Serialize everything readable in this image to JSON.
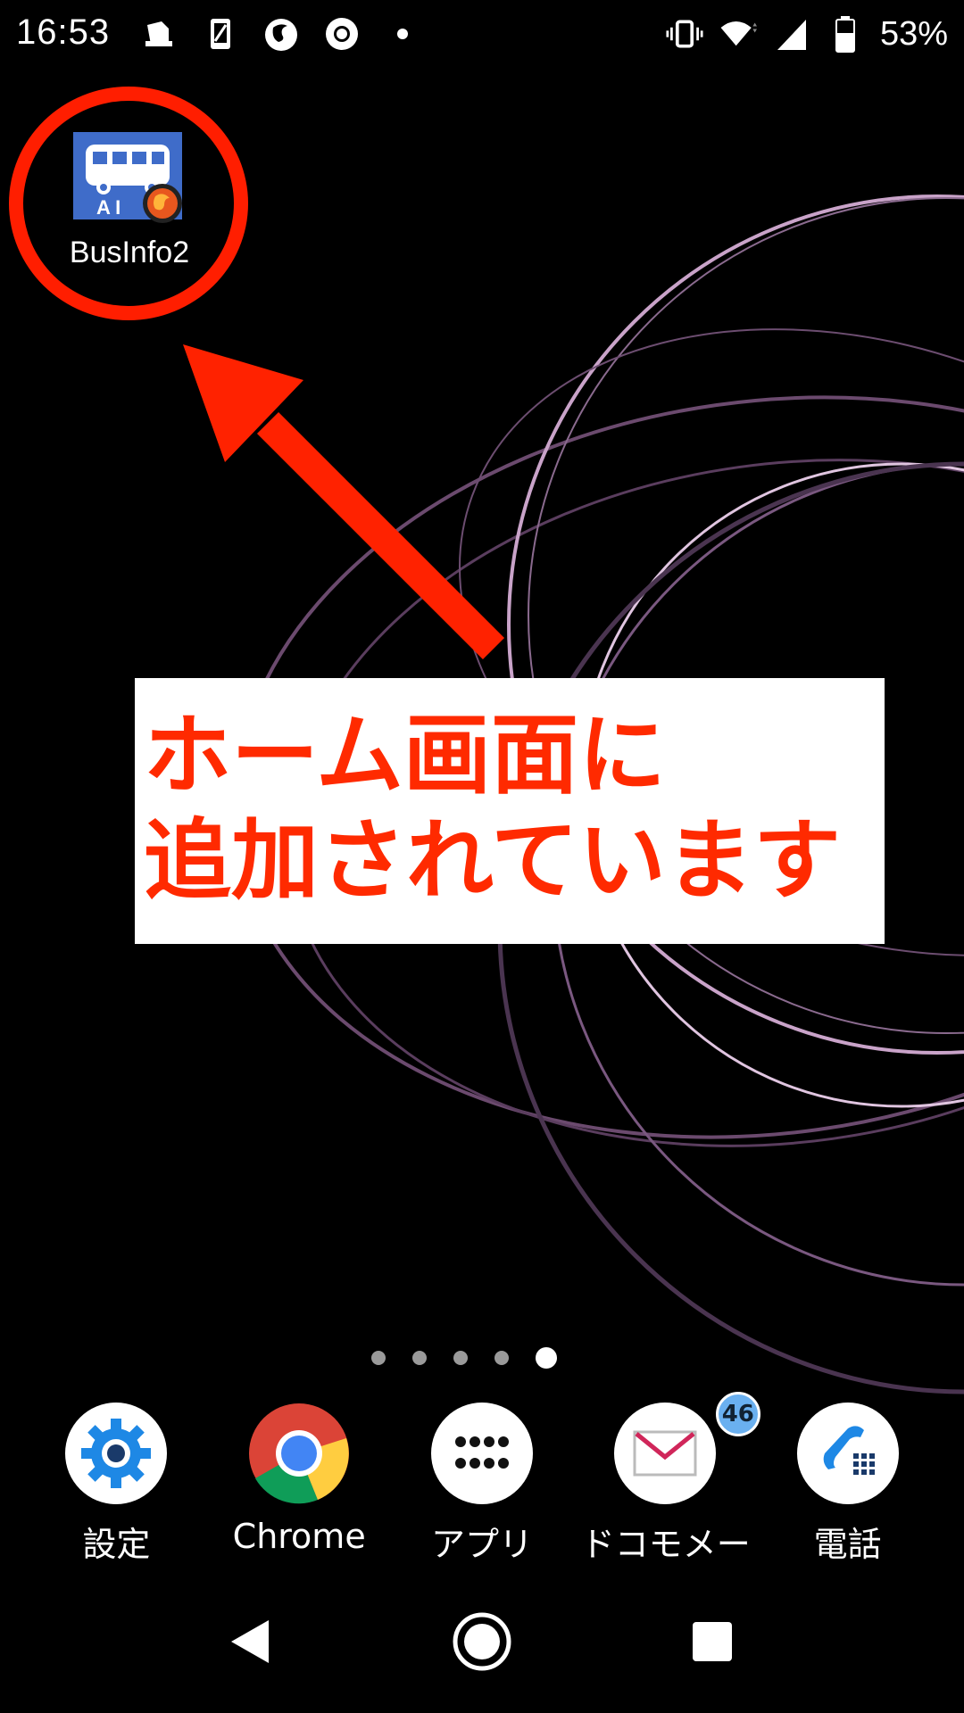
{
  "status_bar": {
    "time": "16:53",
    "left_icons": [
      "notification-app-icon",
      "notification-phone-icon",
      "firefox-icon",
      "chrome-icon",
      "dot-icon"
    ],
    "right_icons": [
      "vibrate-icon",
      "wifi-icon",
      "signal-icon",
      "battery-icon"
    ],
    "battery_percent": "53%"
  },
  "home": {
    "shortcut": {
      "label": "BusInfo2",
      "icon_text": "A I"
    },
    "callout_lines": [
      "ホーム画面に",
      "追加されています"
    ]
  },
  "page_indicator": {
    "count": 5,
    "active_index": 4
  },
  "dock": [
    {
      "label": "設定",
      "icon": "settings-icon"
    },
    {
      "label": "Chrome",
      "icon": "chrome-icon"
    },
    {
      "label": "アプリ",
      "icon": "apps-icon"
    },
    {
      "label": "ドコモメー",
      "icon": "mail-icon",
      "badge": "46"
    },
    {
      "label": "電話",
      "icon": "phone-icon"
    }
  ],
  "nav": [
    "back-icon",
    "home-icon",
    "recents-icon"
  ],
  "colors": {
    "annotation_red": "#ff1e00",
    "badge_blue": "#6ab0f0",
    "wallpaper_lines": "#b58ab0"
  }
}
